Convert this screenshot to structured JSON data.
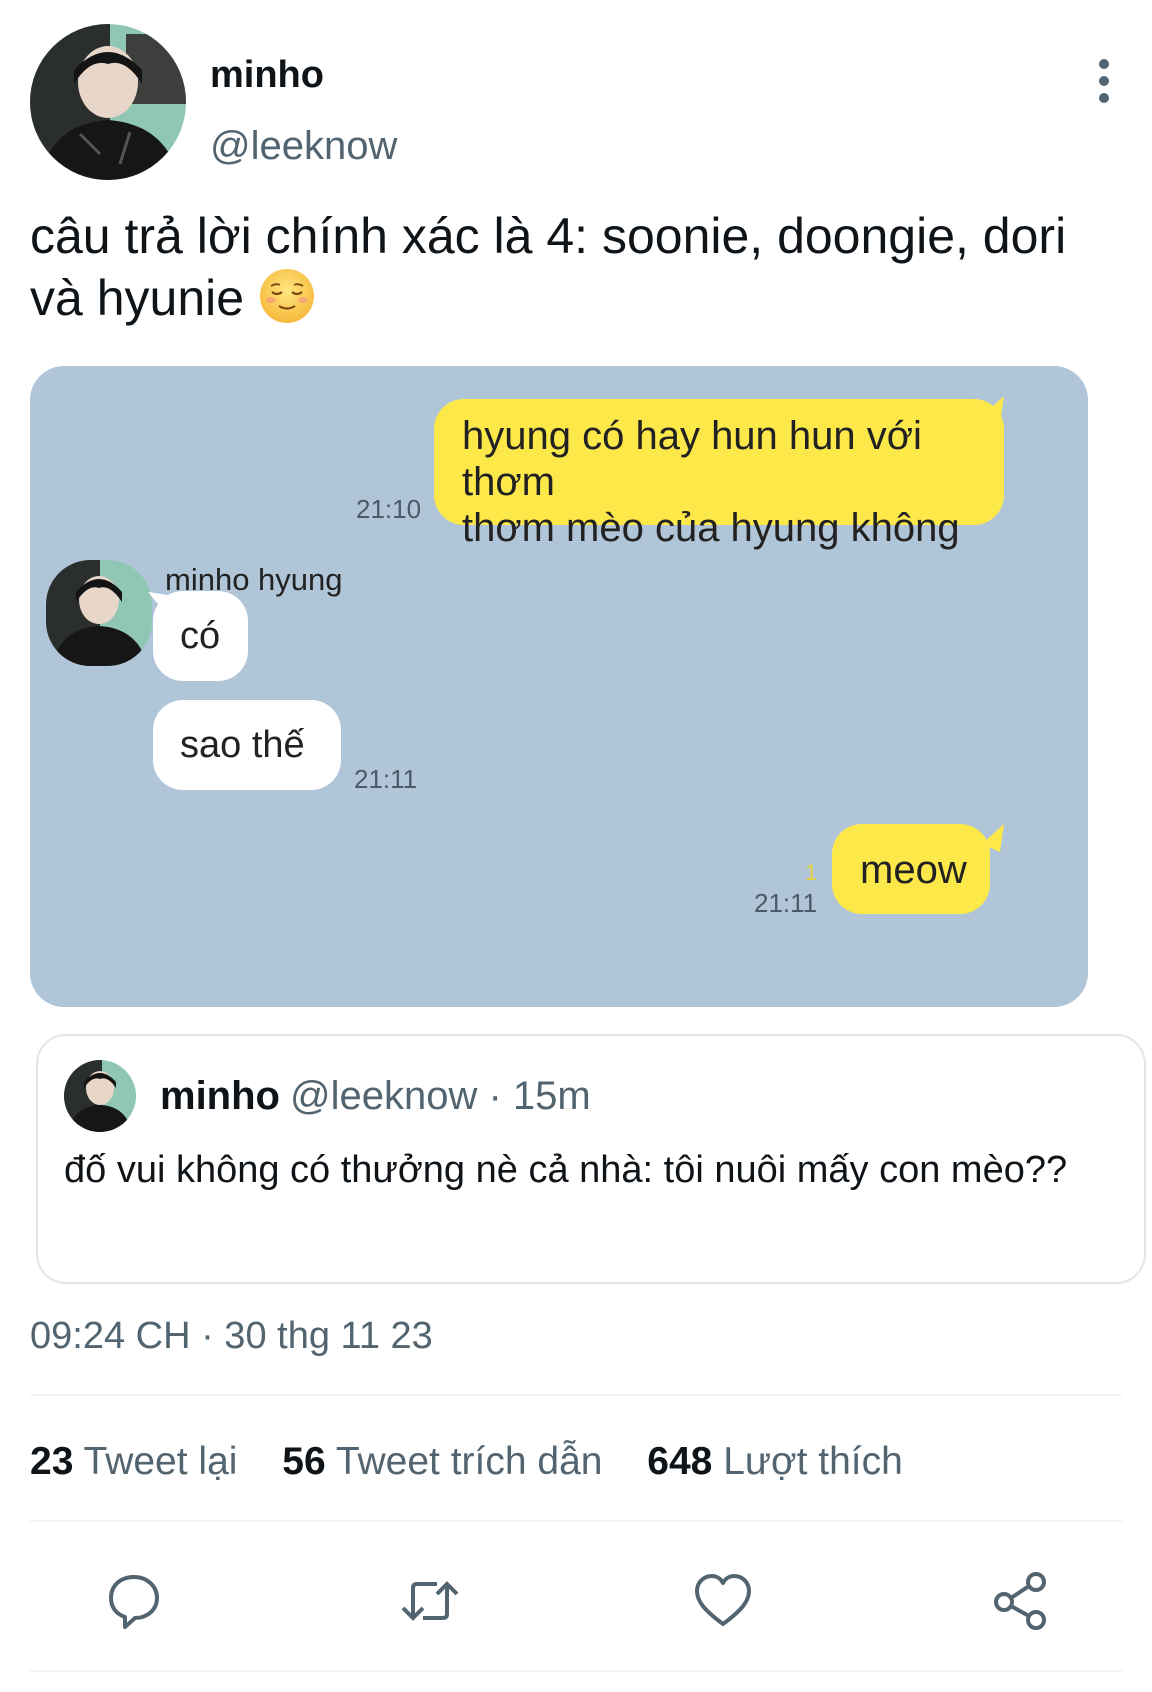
{
  "author": {
    "display_name": "minho",
    "handle": "@leeknow"
  },
  "tweet": {
    "text": "câu trả lời chính xác là 4: soonie, doongie, dori và hyunie",
    "emoji": "relieved-face-emoji"
  },
  "chat": {
    "messages": [
      {
        "side": "right",
        "text_line1": "hyung có hay hun hun với thơm",
        "text_line2": "thơm mèo của hyung không",
        "time": "21:10"
      },
      {
        "side": "left",
        "sender": "minho hyung",
        "text": "có"
      },
      {
        "side": "left",
        "text": "sao thế",
        "time": "21:11"
      },
      {
        "side": "right",
        "text": "meow",
        "time": "21:11",
        "unread": "1"
      }
    ],
    "colors": {
      "background": "#b1c5d8",
      "outgoing": "#fde84a",
      "incoming": "#ffffff"
    }
  },
  "quoted": {
    "display_name": "minho",
    "meta": "@leeknow · 15m",
    "text": "đố vui không có thưởng nè cả nhà: tôi nuôi mấy con mèo??"
  },
  "timestamp": "09:24 CH · 30 thg 11 23",
  "stats": {
    "retweets": {
      "count": "23",
      "label": "Tweet lại"
    },
    "quotes": {
      "count": "56",
      "label": "Tweet trích dẫn"
    },
    "likes": {
      "count": "648",
      "label": "Lượt thích"
    }
  },
  "actions": [
    "reply-icon",
    "retweet-icon",
    "like-icon",
    "share-icon"
  ]
}
